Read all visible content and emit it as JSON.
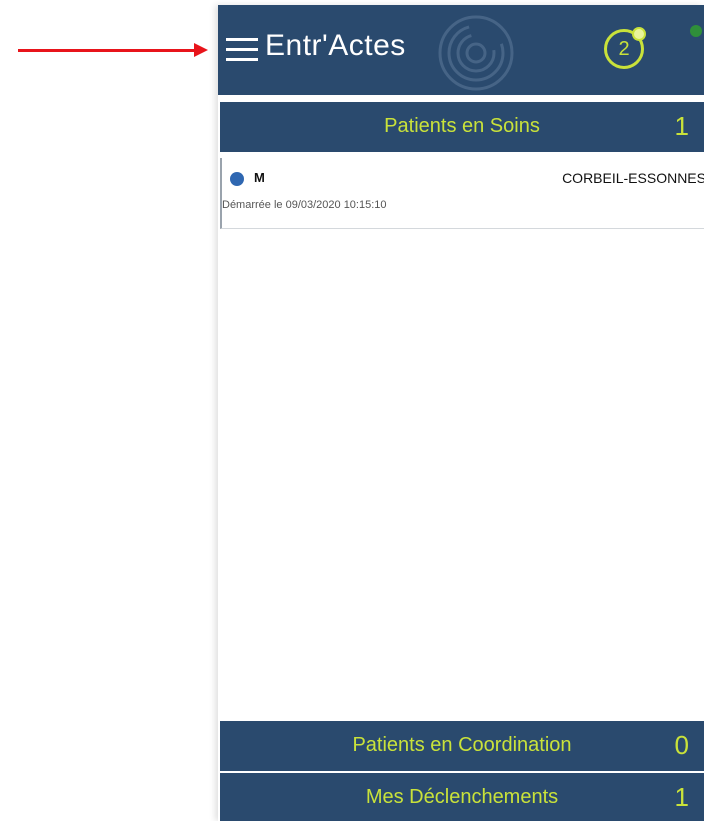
{
  "app": {
    "title": "Entr'Actes",
    "notification_count": "2"
  },
  "sections": [
    {
      "label": "Patients en Soins",
      "count": "1"
    },
    {
      "label": "Patients en Coordination",
      "count": "0"
    },
    {
      "label": "Mes Déclenchements",
      "count": "1"
    }
  ],
  "patients": [
    {
      "name": "M",
      "city": "CORBEIL-ESSONNES",
      "started": "Démarrée le 09/03/2020 10:15:10"
    }
  ],
  "colors": {
    "header_bg": "#2a4a6e",
    "accent": "#c9e23a",
    "annotation_arrow": "#e8141b",
    "status_online": "#2f8f3a",
    "patient_bullet": "#2f67b1"
  },
  "icons": {
    "menu": "hamburger-menu-icon",
    "watermark": "app-logo-watermark",
    "notification": "notification-badge-icon",
    "status": "online-status-dot",
    "annotation": "red-arrow-pointer"
  }
}
